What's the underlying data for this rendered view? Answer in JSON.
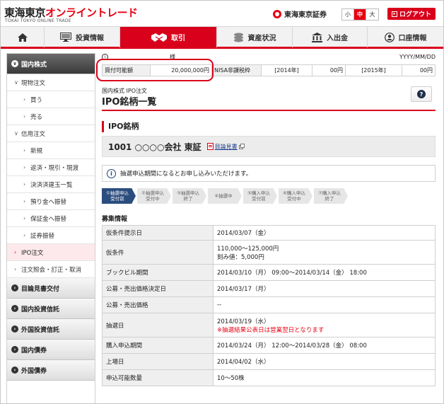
{
  "header": {
    "logo_black": "東海東京",
    "logo_red": "オンライントレード",
    "logo_sub": "TOKAI TOKYO ONLINE TRADE",
    "brand_name": "東海東京証券",
    "font_sizes": [
      {
        "label": "小",
        "active": false
      },
      {
        "label": "中",
        "active": true
      },
      {
        "label": "大",
        "active": false
      }
    ],
    "logout_label": "ログアウト"
  },
  "nav": {
    "items": [
      {
        "label": "",
        "icon": "home-icon",
        "active": false
      },
      {
        "label": "投資情報",
        "icon": "monitor-icon",
        "active": false
      },
      {
        "label": "取引",
        "icon": "handshake-icon",
        "active": true
      },
      {
        "label": "資産状況",
        "icon": "coins-icon",
        "active": false
      },
      {
        "label": "入出金",
        "icon": "bank-icon",
        "active": false
      },
      {
        "label": "口座情報",
        "icon": "user-icon",
        "active": false
      }
    ]
  },
  "sidebar": {
    "top_category": "国内株式",
    "items": [
      {
        "label": "現物注文",
        "level": 1,
        "chev": "∨",
        "active": false
      },
      {
        "label": "買う",
        "level": 2,
        "chev": "›",
        "active": false
      },
      {
        "label": "売る",
        "level": 2,
        "chev": "›",
        "active": false
      },
      {
        "label": "信用注文",
        "level": 1,
        "chev": "∨",
        "active": false
      },
      {
        "label": "新規",
        "level": 2,
        "chev": "›",
        "active": false
      },
      {
        "label": "返済・現引・現渡",
        "level": 2,
        "chev": "›",
        "active": false
      },
      {
        "label": "決済済建玉一覧",
        "level": 2,
        "chev": "›",
        "active": false
      },
      {
        "label": "預り金へ振替",
        "level": 2,
        "chev": "›",
        "active": false
      },
      {
        "label": "保証金へ振替",
        "level": 2,
        "chev": "›",
        "active": false
      },
      {
        "label": "証券振替",
        "level": 2,
        "chev": "›",
        "active": false
      },
      {
        "label": "IPO注文",
        "level": 1,
        "chev": "›",
        "active": true
      },
      {
        "label": "注文照会・訂正・取消",
        "level": 1,
        "chev": "›",
        "active": false
      }
    ],
    "categories": [
      "目論見書交付",
      "国内投資信託",
      "外国投資信託",
      "国内債券",
      "外国債券"
    ]
  },
  "account": {
    "sama": "様",
    "date": "YYYY/MM/DD",
    "buying_power_label": "買付可能額",
    "buying_power_value": "20,000,000円",
    "nisa_label": "NISA非課税枠",
    "year1": "[2014年]",
    "year1_value": "00円",
    "year2": "[2015年]",
    "year2_value": "00円"
  },
  "page": {
    "breadcrumb": "国内株式 IPO注文",
    "title": "IPO銘柄一覧",
    "section": "IPO銘柄",
    "security_name": "1001 ○○○○会社 東証",
    "prospectus_link": "目論見書",
    "info_text": "抽選申込期間になるとお申し込みいただけます。",
    "steps": [
      {
        "line1": "①抽選申込",
        "line2": "受付前",
        "active": true
      },
      {
        "line1": "②抽選申込",
        "line2": "受付中",
        "active": false
      },
      {
        "line1": "③抽選申込",
        "line2": "終了",
        "active": false
      },
      {
        "line1": "④抽選中",
        "line2": "",
        "active": false
      },
      {
        "line1": "⑤購入申込",
        "line2": "受付前",
        "active": false
      },
      {
        "line1": "⑥購入申込",
        "line2": "受付中",
        "active": false
      },
      {
        "line1": "⑦購入申込",
        "line2": "終了",
        "active": false
      }
    ],
    "details_title": "募集情報",
    "details": [
      {
        "label": "仮条件提示日",
        "value": "2014/03/07（金）",
        "note": ""
      },
      {
        "label": "仮条件",
        "value": "110,000～125,000円",
        "value2": "刻み値：5,000円",
        "note": ""
      },
      {
        "label": "ブックビル期間",
        "value": "2014/03/10（月） 09:00～2014/03/14（金） 18:00",
        "note": ""
      },
      {
        "label": "公募・売出価格決定日",
        "value": "2014/03/17（月）",
        "note": ""
      },
      {
        "label": "公募・売出価格",
        "value": "--",
        "note": ""
      },
      {
        "label": "抽選日",
        "value": "2014/03/19（水）",
        "note": "※抽選結果公表日は営業翌日となります"
      },
      {
        "label": "購入申込期間",
        "value": "2014/03/24（月） 12:00～2014/03/28（金） 08:00",
        "note": ""
      },
      {
        "label": "上場日",
        "value": "2014/04/02（水）",
        "note": ""
      },
      {
        "label": "申込可能数量",
        "value": "10～50株",
        "note": ""
      }
    ]
  }
}
